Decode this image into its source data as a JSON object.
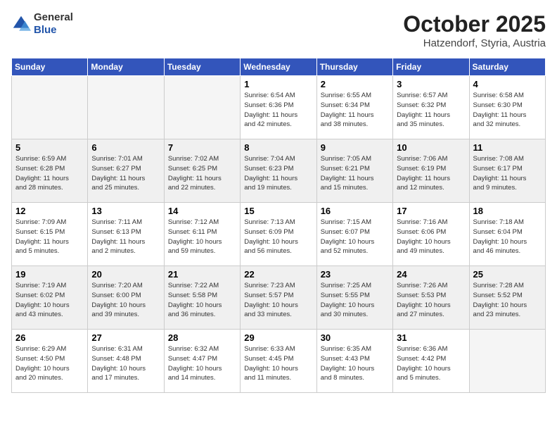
{
  "logo": {
    "general": "General",
    "blue": "Blue"
  },
  "header": {
    "month": "October 2025",
    "location": "Hatzendorf, Styria, Austria"
  },
  "days_of_week": [
    "Sunday",
    "Monday",
    "Tuesday",
    "Wednesday",
    "Thursday",
    "Friday",
    "Saturday"
  ],
  "weeks": [
    [
      {
        "date": "",
        "info": ""
      },
      {
        "date": "",
        "info": ""
      },
      {
        "date": "",
        "info": ""
      },
      {
        "date": "1",
        "info": "Sunrise: 6:54 AM\nSunset: 6:36 PM\nDaylight: 11 hours\nand 42 minutes."
      },
      {
        "date": "2",
        "info": "Sunrise: 6:55 AM\nSunset: 6:34 PM\nDaylight: 11 hours\nand 38 minutes."
      },
      {
        "date": "3",
        "info": "Sunrise: 6:57 AM\nSunset: 6:32 PM\nDaylight: 11 hours\nand 35 minutes."
      },
      {
        "date": "4",
        "info": "Sunrise: 6:58 AM\nSunset: 6:30 PM\nDaylight: 11 hours\nand 32 minutes."
      }
    ],
    [
      {
        "date": "5",
        "info": "Sunrise: 6:59 AM\nSunset: 6:28 PM\nDaylight: 11 hours\nand 28 minutes."
      },
      {
        "date": "6",
        "info": "Sunrise: 7:01 AM\nSunset: 6:27 PM\nDaylight: 11 hours\nand 25 minutes."
      },
      {
        "date": "7",
        "info": "Sunrise: 7:02 AM\nSunset: 6:25 PM\nDaylight: 11 hours\nand 22 minutes."
      },
      {
        "date": "8",
        "info": "Sunrise: 7:04 AM\nSunset: 6:23 PM\nDaylight: 11 hours\nand 19 minutes."
      },
      {
        "date": "9",
        "info": "Sunrise: 7:05 AM\nSunset: 6:21 PM\nDaylight: 11 hours\nand 15 minutes."
      },
      {
        "date": "10",
        "info": "Sunrise: 7:06 AM\nSunset: 6:19 PM\nDaylight: 11 hours\nand 12 minutes."
      },
      {
        "date": "11",
        "info": "Sunrise: 7:08 AM\nSunset: 6:17 PM\nDaylight: 11 hours\nand 9 minutes."
      }
    ],
    [
      {
        "date": "12",
        "info": "Sunrise: 7:09 AM\nSunset: 6:15 PM\nDaylight: 11 hours\nand 5 minutes."
      },
      {
        "date": "13",
        "info": "Sunrise: 7:11 AM\nSunset: 6:13 PM\nDaylight: 11 hours\nand 2 minutes."
      },
      {
        "date": "14",
        "info": "Sunrise: 7:12 AM\nSunset: 6:11 PM\nDaylight: 10 hours\nand 59 minutes."
      },
      {
        "date": "15",
        "info": "Sunrise: 7:13 AM\nSunset: 6:09 PM\nDaylight: 10 hours\nand 56 minutes."
      },
      {
        "date": "16",
        "info": "Sunrise: 7:15 AM\nSunset: 6:07 PM\nDaylight: 10 hours\nand 52 minutes."
      },
      {
        "date": "17",
        "info": "Sunrise: 7:16 AM\nSunset: 6:06 PM\nDaylight: 10 hours\nand 49 minutes."
      },
      {
        "date": "18",
        "info": "Sunrise: 7:18 AM\nSunset: 6:04 PM\nDaylight: 10 hours\nand 46 minutes."
      }
    ],
    [
      {
        "date": "19",
        "info": "Sunrise: 7:19 AM\nSunset: 6:02 PM\nDaylight: 10 hours\nand 43 minutes."
      },
      {
        "date": "20",
        "info": "Sunrise: 7:20 AM\nSunset: 6:00 PM\nDaylight: 10 hours\nand 39 minutes."
      },
      {
        "date": "21",
        "info": "Sunrise: 7:22 AM\nSunset: 5:58 PM\nDaylight: 10 hours\nand 36 minutes."
      },
      {
        "date": "22",
        "info": "Sunrise: 7:23 AM\nSunset: 5:57 PM\nDaylight: 10 hours\nand 33 minutes."
      },
      {
        "date": "23",
        "info": "Sunrise: 7:25 AM\nSunset: 5:55 PM\nDaylight: 10 hours\nand 30 minutes."
      },
      {
        "date": "24",
        "info": "Sunrise: 7:26 AM\nSunset: 5:53 PM\nDaylight: 10 hours\nand 27 minutes."
      },
      {
        "date": "25",
        "info": "Sunrise: 7:28 AM\nSunset: 5:52 PM\nDaylight: 10 hours\nand 23 minutes."
      }
    ],
    [
      {
        "date": "26",
        "info": "Sunrise: 6:29 AM\nSunset: 4:50 PM\nDaylight: 10 hours\nand 20 minutes."
      },
      {
        "date": "27",
        "info": "Sunrise: 6:31 AM\nSunset: 4:48 PM\nDaylight: 10 hours\nand 17 minutes."
      },
      {
        "date": "28",
        "info": "Sunrise: 6:32 AM\nSunset: 4:47 PM\nDaylight: 10 hours\nand 14 minutes."
      },
      {
        "date": "29",
        "info": "Sunrise: 6:33 AM\nSunset: 4:45 PM\nDaylight: 10 hours\nand 11 minutes."
      },
      {
        "date": "30",
        "info": "Sunrise: 6:35 AM\nSunset: 4:43 PM\nDaylight: 10 hours\nand 8 minutes."
      },
      {
        "date": "31",
        "info": "Sunrise: 6:36 AM\nSunset: 4:42 PM\nDaylight: 10 hours\nand 5 minutes."
      },
      {
        "date": "",
        "info": ""
      }
    ]
  ]
}
